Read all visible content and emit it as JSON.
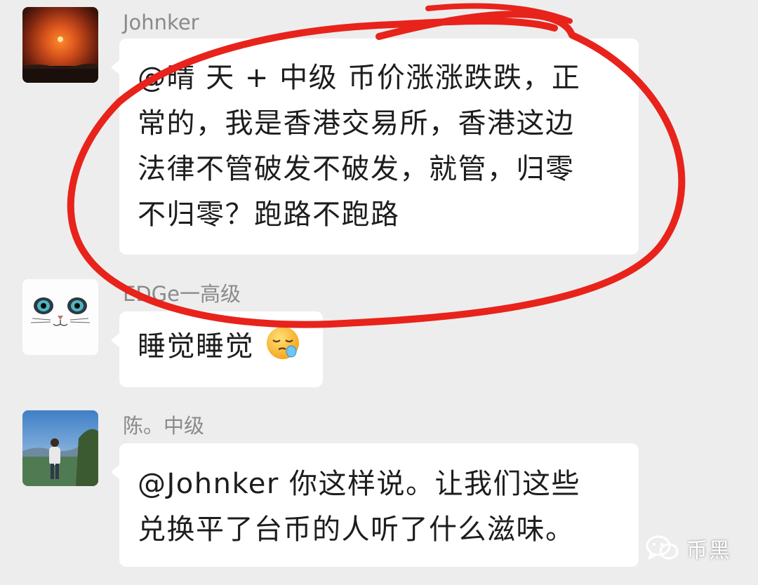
{
  "messages": [
    {
      "sender": "Johnker",
      "avatar_icon": "sunset-avatar",
      "lines": [
        "@晴 天 + 中级  币价涨涨跌跌，正",
        "常的，我是香港交易所，香港这边",
        "法律不管破发不破发，就管，归零",
        "不归零？跑路不跑路"
      ]
    },
    {
      "sender": "EDGe一高级",
      "avatar_icon": "cat-face-avatar",
      "text": "睡觉睡觉",
      "emoji_icon": "sleeping-face-emoji"
    },
    {
      "sender": "陈。中级",
      "avatar_icon": "person-landscape-avatar",
      "lines": [
        "@Johnker  你这样说。让我们这些",
        "兑换平了台币的人听了什么滋味。"
      ]
    }
  ],
  "annotation": {
    "type": "hand-drawn-circle",
    "color": "#e8231b"
  },
  "watermark": {
    "text": "币黑",
    "icon": "wechat-logo-icon"
  }
}
